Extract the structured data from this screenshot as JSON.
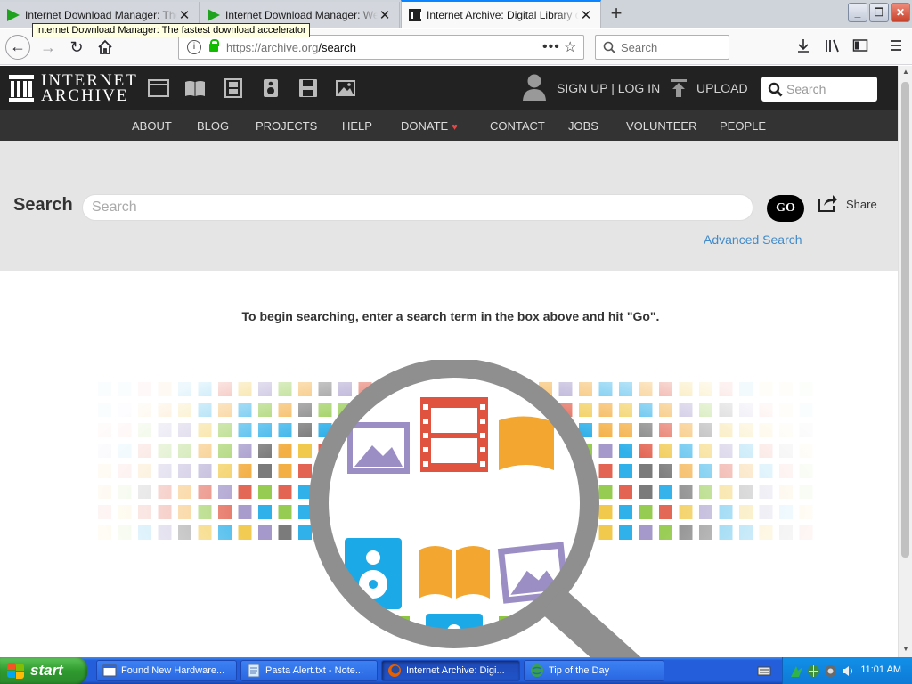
{
  "browser": {
    "tabs": [
      {
        "title": "Internet Download Manager: The fastest download accelerator",
        "active": false
      },
      {
        "title": "Internet Download Manager: Welcome",
        "active": false
      },
      {
        "title": "Internet Archive: Digital Library of Free & Borrowable Books",
        "active": true
      }
    ],
    "tooltip": "Internet Download Manager: The fastest download accelerator",
    "url_host": "https://archive.org",
    "url_path": "/search",
    "search_placeholder": "Search"
  },
  "ia": {
    "logo_line1": "INTERNET",
    "logo_line2": "ARCHIVE",
    "signup": "SIGN UP | LOG IN",
    "upload": "UPLOAD",
    "search_placeholder": "Search",
    "nav": [
      "ABOUT",
      "BLOG",
      "PROJECTS",
      "HELP",
      "DONATE",
      "CONTACT",
      "JOBS",
      "VOLUNTEER",
      "PEOPLE"
    ],
    "search_label": "Search",
    "big_search_placeholder": "Search",
    "go_label": "GO",
    "share_label": "Share",
    "advanced_search": "Advanced Search",
    "hint": "To begin searching, enter a search term in the box above and hit \"Go\"."
  },
  "taskbar": {
    "start_label": "start",
    "tasks": [
      {
        "title": "Found New Hardware...",
        "active": false
      },
      {
        "title": "Pasta Alert.txt - Note...",
        "active": false
      },
      {
        "title": "Internet Archive: Digi...",
        "active": true
      },
      {
        "title": "Tip of the Day",
        "active": false
      }
    ],
    "clock": "11:01 AM"
  },
  "colors": {
    "ia_dark": "#222222",
    "ia_nav": "#333333",
    "search_band": "#e5e5e5",
    "link_blue": "#428bca",
    "firefox_accent": "#0a84ff",
    "xp_blue": "#245edb",
    "xp_start_green": "#2f9a2f"
  }
}
